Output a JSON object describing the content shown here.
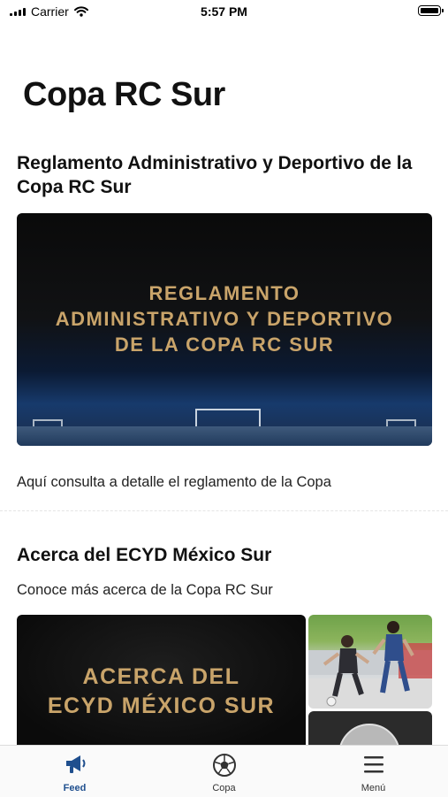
{
  "status_bar": {
    "carrier": "Carrier",
    "time": "5:57 PM"
  },
  "page": {
    "title": "Copa RC Sur"
  },
  "cards": [
    {
      "title": "Reglamento Administrativo y Deportivo de la Copa RC Sur",
      "image_text": [
        "REGLAMENTO",
        "ADMINISTRATIVO Y DEPORTIVO",
        "DE LA COPA RC SUR"
      ],
      "description": "Aquí consulta a detalle el reglamento de la Copa"
    },
    {
      "title": "Acerca del ECYD México Sur",
      "description": "Conoce más acerca de la Copa RC Sur",
      "image_text": [
        "ACERCA DEL",
        "ECYD MÉXICO SUR"
      ]
    }
  ],
  "tabs": [
    {
      "label": "Feed",
      "icon": "megaphone-icon",
      "active": true
    },
    {
      "label": "Copa",
      "icon": "soccer-ball-icon",
      "active": false
    },
    {
      "label": "Menú",
      "icon": "menu-icon",
      "active": false
    }
  ],
  "colors": {
    "accent": "#1f4f8e",
    "gold_text": "#c9a46a"
  }
}
